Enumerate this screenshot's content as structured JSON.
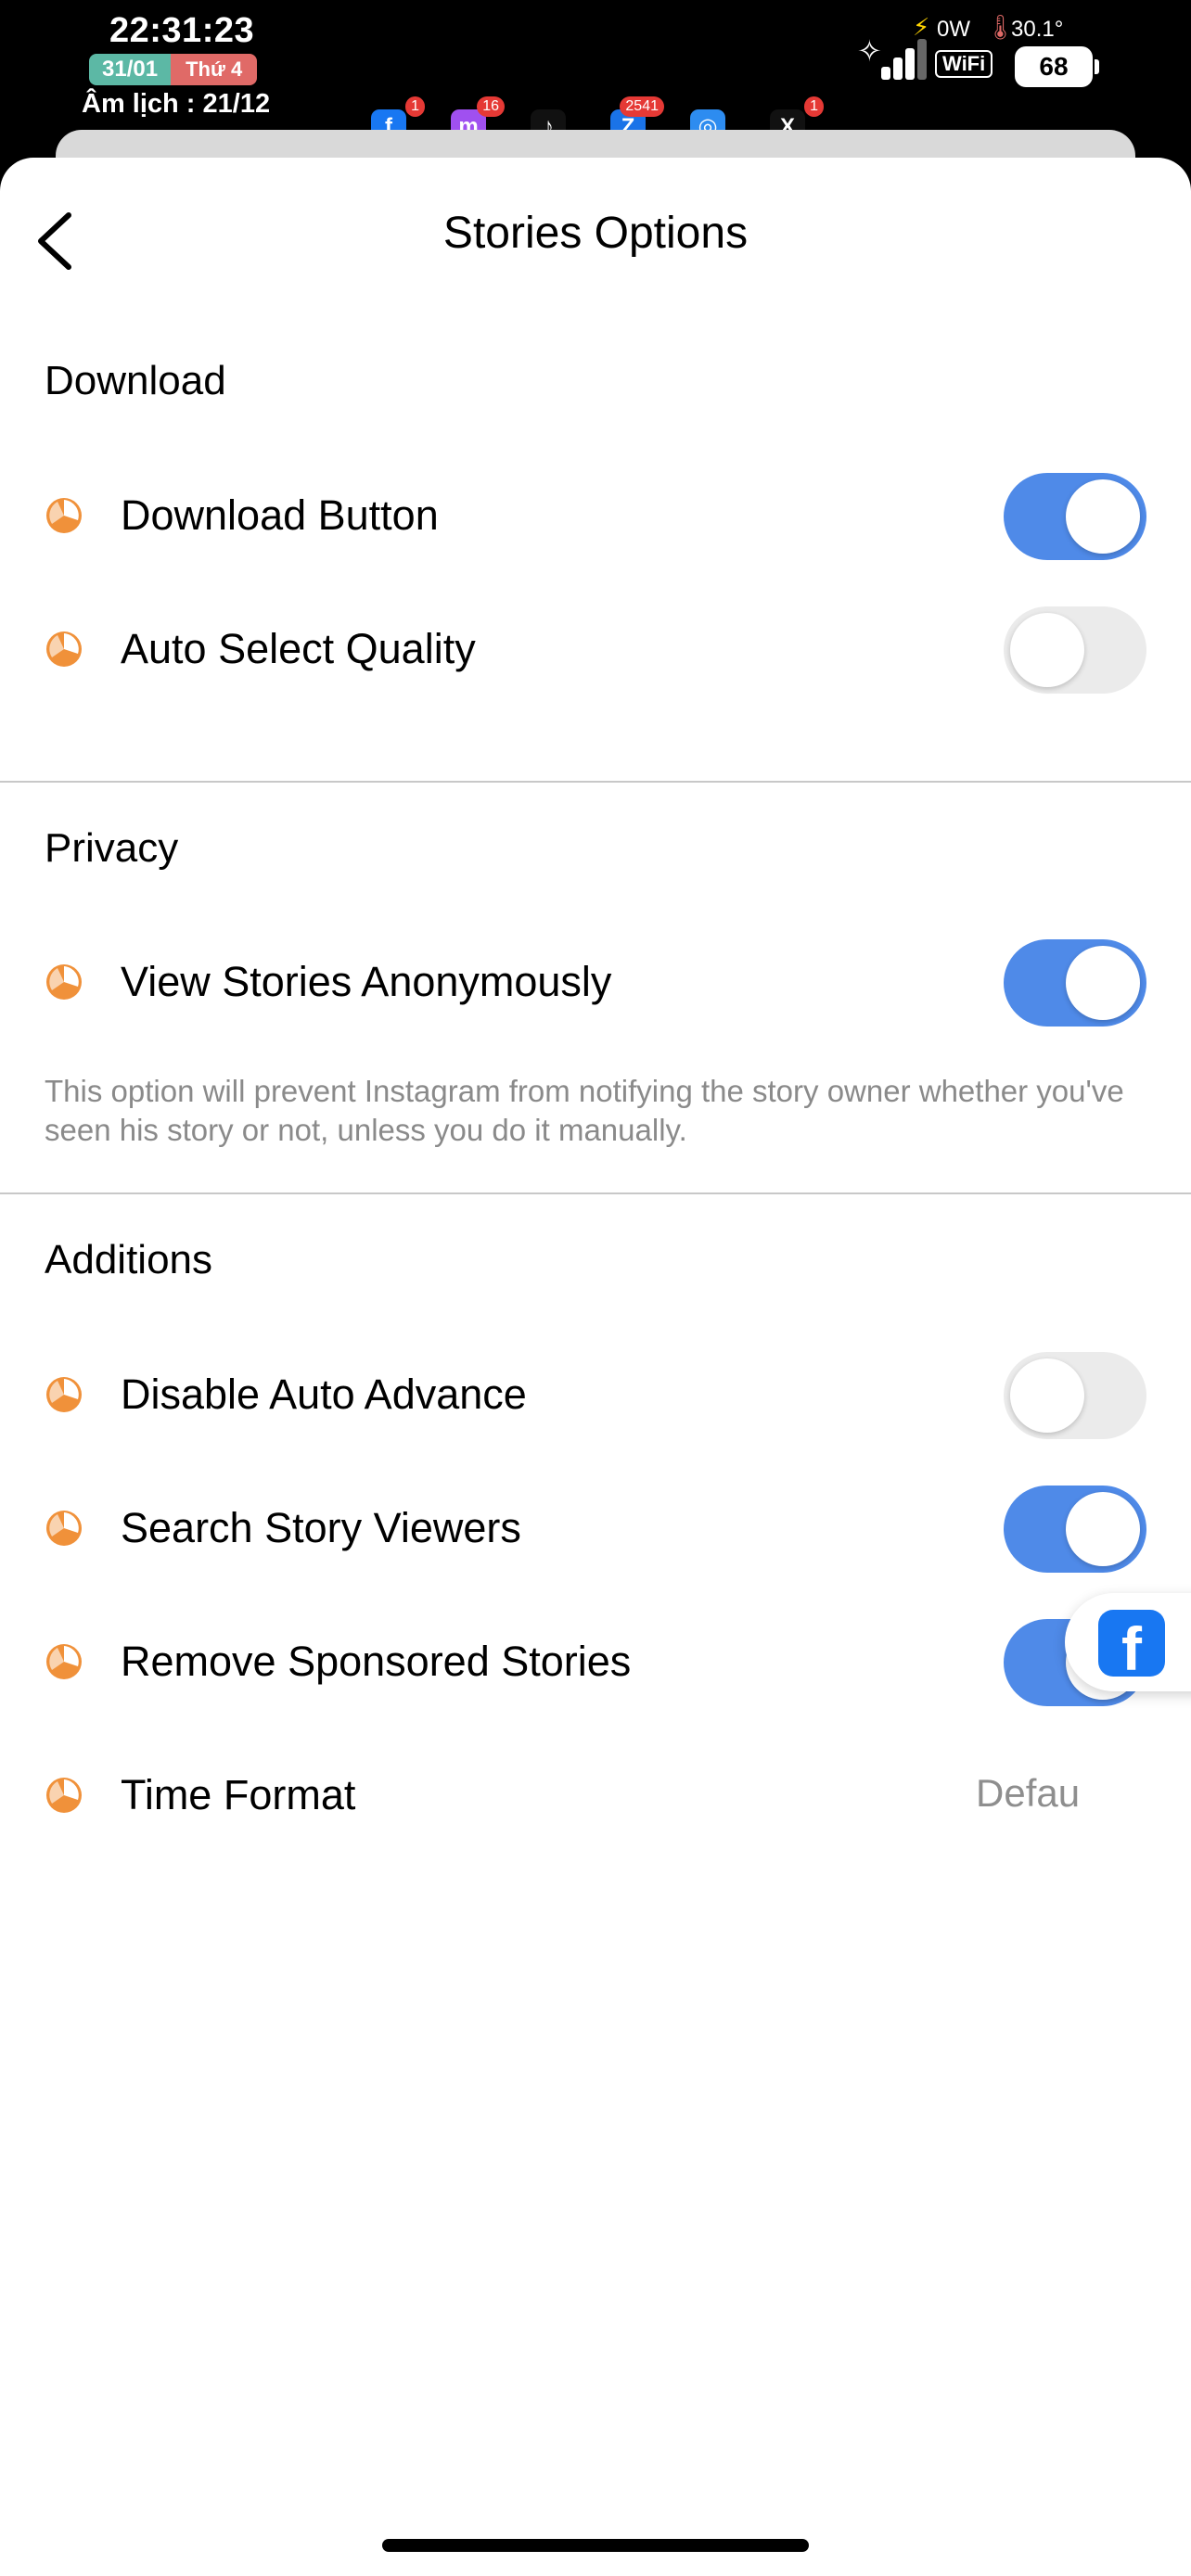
{
  "status_bar": {
    "time": "22:31:23",
    "date": "31/01",
    "weekday": "Thứ 4",
    "lunar": "Âm lịch : 21/12",
    "power": "0W",
    "temperature": "30.1°",
    "wifi_label": "WiFi",
    "battery": "68",
    "apps": [
      {
        "name": "Facebook",
        "badge": "1",
        "color": "#1877f2",
        "glyph": "f"
      },
      {
        "name": "Messenger",
        "badge": "16",
        "color": "#a050f0",
        "glyph": "m"
      },
      {
        "name": "TikTok",
        "badge": "",
        "color": "#111111",
        "glyph": "♪"
      },
      {
        "name": "Zalo",
        "badge": "2541",
        "color": "#1a73e8",
        "glyph": "Z"
      },
      {
        "name": "Safari",
        "badge": "",
        "color": "#2d8cf0",
        "glyph": "◎"
      },
      {
        "name": "X",
        "badge": "1",
        "color": "#111111",
        "glyph": "X"
      }
    ]
  },
  "header": {
    "title": "Stories Options",
    "back_icon": "chevron-left-icon"
  },
  "sections": {
    "download": {
      "title": "Download",
      "items": [
        {
          "label": "Download Button",
          "enabled": true
        },
        {
          "label": "Auto Select Quality",
          "enabled": false
        }
      ]
    },
    "privacy": {
      "title": "Privacy",
      "items": [
        {
          "label": "View Stories Anonymously",
          "enabled": true
        }
      ],
      "note": "This option will prevent Instagram from notifying the story owner whether you've seen his story or not, unless you do it manually."
    },
    "additions": {
      "title": "Additions",
      "items": [
        {
          "label": "Disable Auto Advance",
          "enabled": false
        },
        {
          "label": "Search Story Viewers",
          "enabled": true
        },
        {
          "label": "Remove Sponsored Stories",
          "enabled": true
        },
        {
          "label": "Time Format",
          "value": "Defau"
        }
      ]
    }
  },
  "colors": {
    "toggle_on": "#4f8ae8",
    "toggle_off": "#ebebeb",
    "item_icon": "#f0913a"
  },
  "floating_bubble": {
    "icon": "facebook-icon"
  }
}
